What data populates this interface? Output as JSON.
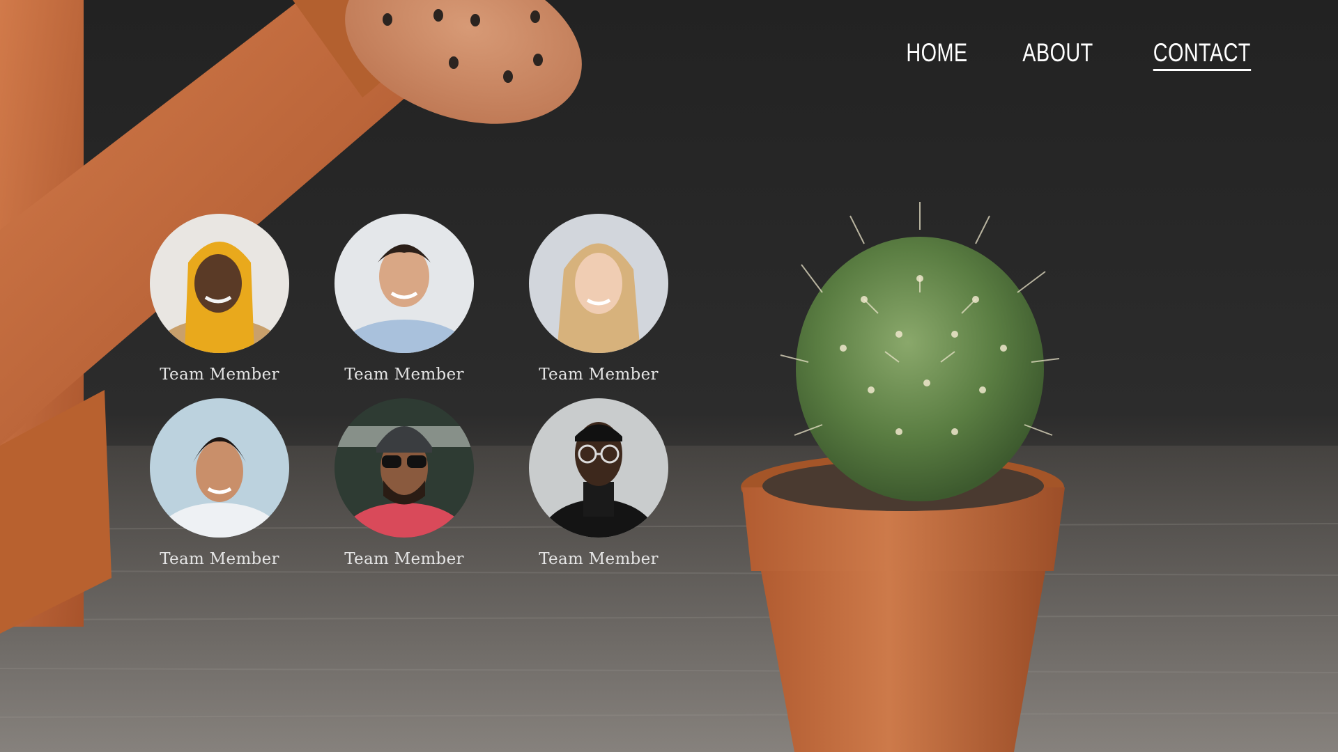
{
  "nav": {
    "items": [
      {
        "label": "HOME",
        "active": false
      },
      {
        "label": "ABOUT",
        "active": false
      },
      {
        "label": "CONTACT",
        "active": true
      }
    ]
  },
  "team": {
    "members": [
      {
        "name": "Team Member"
      },
      {
        "name": "Team Member"
      },
      {
        "name": "Team Member"
      },
      {
        "name": "Team Member"
      },
      {
        "name": "Team Member"
      },
      {
        "name": "Team Member"
      }
    ]
  },
  "colors": {
    "background_dark": "#1f1f1f",
    "watering_can": "#c2683a",
    "pot": "#c06a3c",
    "cactus": "#6a8f4e",
    "floor": "#6e6a66",
    "nav_text": "#ffffff",
    "member_text": "#e4e4e4"
  }
}
